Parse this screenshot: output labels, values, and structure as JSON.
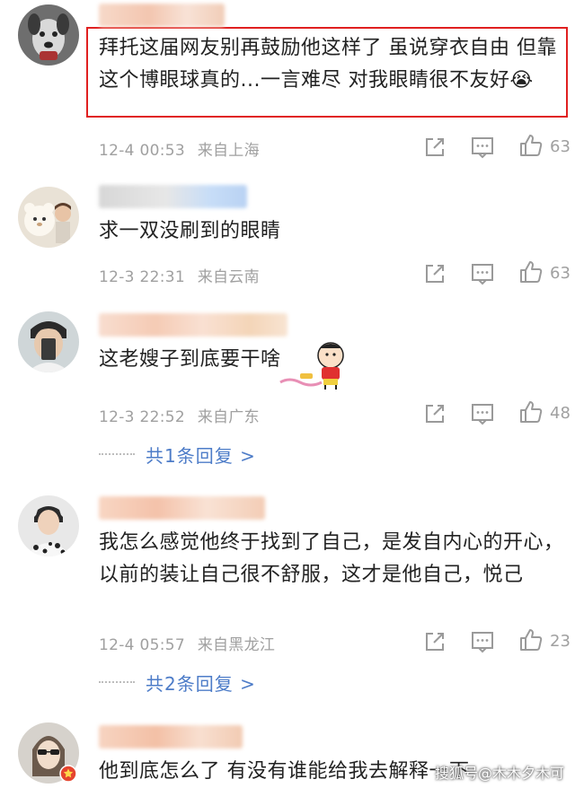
{
  "comments": [
    {
      "text": "拜托这届网友别再鼓励他这样了 虽说穿衣自由 但靠这个博眼球真的...一言难尽 对我眼睛很不友好😭",
      "time": "12-4 00:53",
      "location": "来自上海",
      "likes": "63",
      "avatar": "dog-avatar",
      "highlighted": true
    },
    {
      "text": "求一双没刷到的眼睛",
      "time": "12-3 22:31",
      "location": "来自云南",
      "likes": "63",
      "avatar": "bear-avatar"
    },
    {
      "text": "这老嫂子到底要干啥",
      "time": "12-3 22:52",
      "location": "来自广东",
      "likes": "48",
      "avatar": "selfie-avatar",
      "sticker": "crayon-shin-chan-sticker",
      "replies": "共1条回复 >"
    },
    {
      "text": "我怎么感觉他终于找到了自己，是发自内心的开心，以前的装让自己很不舒服，这才是他自己，悦己",
      "time": "12-4 05:57",
      "location": "来自黑龙江",
      "likes": "23",
      "avatar": "person-avatar",
      "replies": "共2条回复 >"
    },
    {
      "text": "他到底怎么了 有没有谁能给我去解释一下",
      "avatar": "sunglasses-avatar",
      "verified_badge": true
    }
  ],
  "watermark": "搜狐号@木木夕木可",
  "colors": {
    "highlight_border": "#e02020",
    "reply_link": "#4d7cc8",
    "meta_text": "#a0a0a0"
  }
}
